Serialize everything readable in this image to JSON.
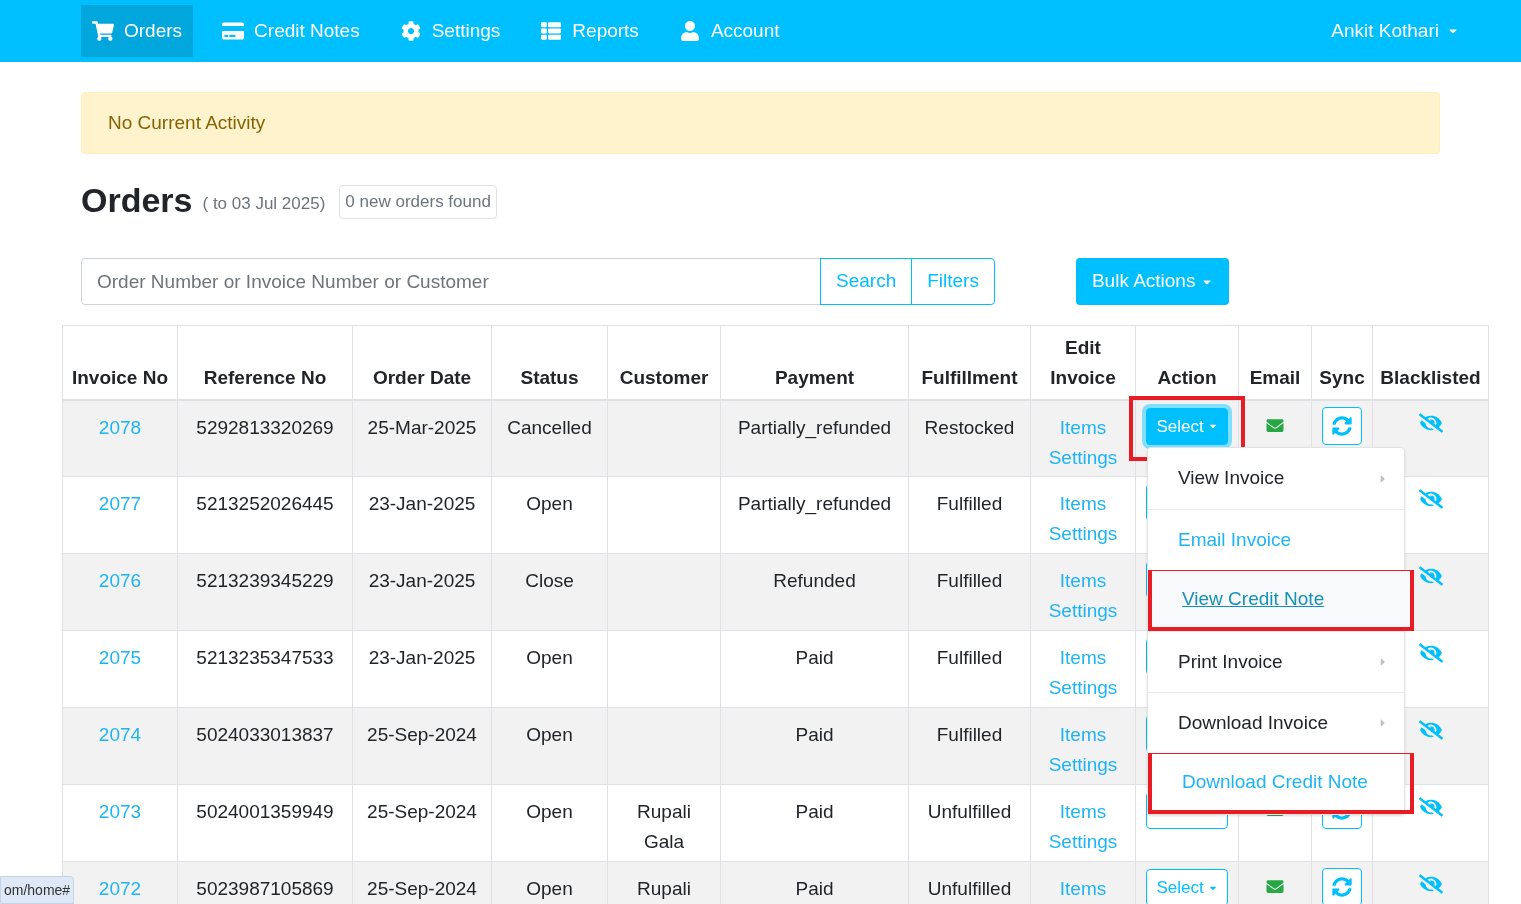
{
  "nav": {
    "items": [
      {
        "label": "Orders",
        "selected": true
      },
      {
        "label": "Credit Notes",
        "selected": false
      },
      {
        "label": "Settings",
        "selected": false
      },
      {
        "label": "Reports",
        "selected": false
      },
      {
        "label": "Account",
        "selected": false
      }
    ],
    "user": "Ankit Kothari"
  },
  "alert": "No Current Activity",
  "heading": {
    "title": "Orders",
    "range": "( to 03 Jul 2025)",
    "badge": "0 new orders found"
  },
  "search": {
    "placeholder": "Order Number or Invoice Number or Customer",
    "buttons": [
      "Search",
      "Filters"
    ],
    "bulk": "Bulk Actions"
  },
  "table": {
    "columns": [
      [
        "Invoice No"
      ],
      [
        "Reference No"
      ],
      [
        "Order Date"
      ],
      [
        "Status"
      ],
      [
        "Customer"
      ],
      [
        "Payment"
      ],
      [
        "Fulfillment"
      ],
      [
        "Edit",
        "Invoice"
      ],
      [
        "Action"
      ],
      [
        "Email"
      ],
      [
        "Sync"
      ],
      [
        "Blacklisted"
      ]
    ],
    "rows": [
      {
        "invoice": "2078",
        "reference": "5292813320269",
        "date": "25-Mar-2025",
        "status": "Cancelled",
        "customer": [],
        "payment": "Partially_refunded",
        "fulfillment": "Restocked",
        "edit": [
          "Items",
          "Settings"
        ],
        "action": {
          "label": "Select",
          "open": true,
          "highlighted": true
        }
      },
      {
        "invoice": "2077",
        "reference": "5213252026445",
        "date": "23-Jan-2025",
        "status": "Open",
        "customer": [],
        "payment": "Partially_refunded",
        "fulfillment": "Fulfilled",
        "edit": [
          "Items",
          "Settings"
        ],
        "action": {
          "open": false,
          "highlighted": false
        }
      },
      {
        "invoice": "2076",
        "reference": "5213239345229",
        "date": "23-Jan-2025",
        "status": "Close",
        "customer": [],
        "payment": "Refunded",
        "fulfillment": "Fulfilled",
        "edit": [
          "Items",
          "Settings"
        ],
        "action": {
          "open": false,
          "highlighted": false
        }
      },
      {
        "invoice": "2075",
        "reference": "5213235347533",
        "date": "23-Jan-2025",
        "status": "Open",
        "customer": [],
        "payment": "Paid",
        "fulfillment": "Fulfilled",
        "edit": [
          "Items",
          "Settings"
        ],
        "action": {
          "open": false,
          "highlighted": false
        }
      },
      {
        "invoice": "2074",
        "reference": "5024033013837",
        "date": "25-Sep-2024",
        "status": "Open",
        "customer": [],
        "payment": "Paid",
        "fulfillment": "Fulfilled",
        "edit": [
          "Items",
          "Settings"
        ],
        "action": {
          "open": false,
          "highlighted": false
        }
      },
      {
        "invoice": "2073",
        "reference": "5024001359949",
        "date": "25-Sep-2024",
        "status": "Open",
        "customer": [
          "Rupali",
          "Gala"
        ],
        "payment": "Paid",
        "fulfillment": "Unfulfilled",
        "edit": [
          "Items",
          "Settings"
        ],
        "action": {
          "open": false,
          "highlighted": false
        }
      },
      {
        "invoice": "2072",
        "reference": "5023987105869",
        "date": "25-Sep-2024",
        "status": "Open",
        "customer": [
          "Rupali"
        ],
        "payment": "Paid",
        "fulfillment": "Unfulfilled",
        "edit": [
          "Items"
        ],
        "action": {
          "label": "Select",
          "open": false,
          "highlighted": false
        }
      }
    ]
  },
  "menu": {
    "items": [
      {
        "label": "View Invoice",
        "kind": "submenu",
        "hovered": false,
        "highlighted": false
      },
      {
        "label": "Email Invoice",
        "kind": "link",
        "hovered": false,
        "highlighted": false
      },
      {
        "label": "View Credit Note",
        "kind": "link",
        "hovered": true,
        "highlighted": true
      },
      {
        "label": "Print Invoice",
        "kind": "submenu",
        "hovered": false,
        "highlighted": false
      },
      {
        "label": "Download Invoice",
        "kind": "submenu",
        "hovered": false,
        "highlighted": false
      },
      {
        "label": "Download Credit Note",
        "kind": "link",
        "hovered": false,
        "highlighted": true
      }
    ]
  },
  "status_url": "om/home#"
}
